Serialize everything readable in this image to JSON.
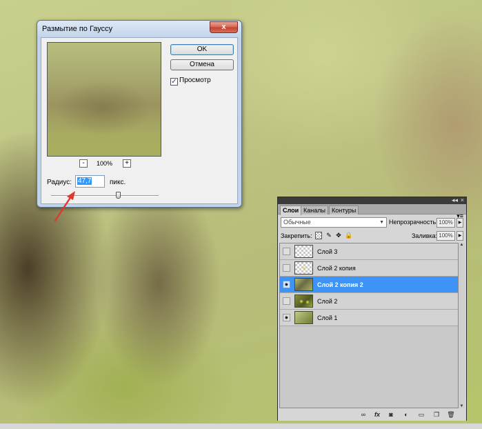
{
  "dialog": {
    "title": "Размытие по Гауссу",
    "close_glyph": "x",
    "ok_label": "OK",
    "cancel_label": "Отмена",
    "preview_label": "Просмотр",
    "preview_checked": true,
    "checkbox_glyph": "✓",
    "zoom_minus": "-",
    "zoom_level": "100%",
    "zoom_plus": "+",
    "radius_label": "Радиус:",
    "radius_value": "47,7",
    "radius_unit": "пикс."
  },
  "layers_panel": {
    "collapse_glyph": "◂◂",
    "close_glyph": "×",
    "menu_glyph": "▾≡",
    "tabs": [
      {
        "label": "Слои",
        "active": true
      },
      {
        "label": "Каналы",
        "active": false
      },
      {
        "label": "Контуры",
        "active": false
      }
    ],
    "blend_mode": "Обычные",
    "opacity_label": "Непрозрачность:",
    "opacity_value": "100%",
    "lock_label": "Закрепить:",
    "fill_label": "Заливка:",
    "fill_value": "100%",
    "layers": [
      {
        "name": "Слой 3",
        "visible": false,
        "selected": false
      },
      {
        "name": "Слой 2 копия",
        "visible": false,
        "selected": false
      },
      {
        "name": "Слой 2 копия 2",
        "visible": true,
        "selected": true
      },
      {
        "name": "Слой 2",
        "visible": false,
        "selected": false
      },
      {
        "name": "Слой 1",
        "visible": true,
        "selected": false
      }
    ],
    "eye_glyph": "●",
    "bottom_icons": [
      "link-icon",
      "fx-icon",
      "mask-icon",
      "adjustment-icon",
      "folder-icon",
      "new-layer-icon",
      "trash-icon"
    ]
  }
}
